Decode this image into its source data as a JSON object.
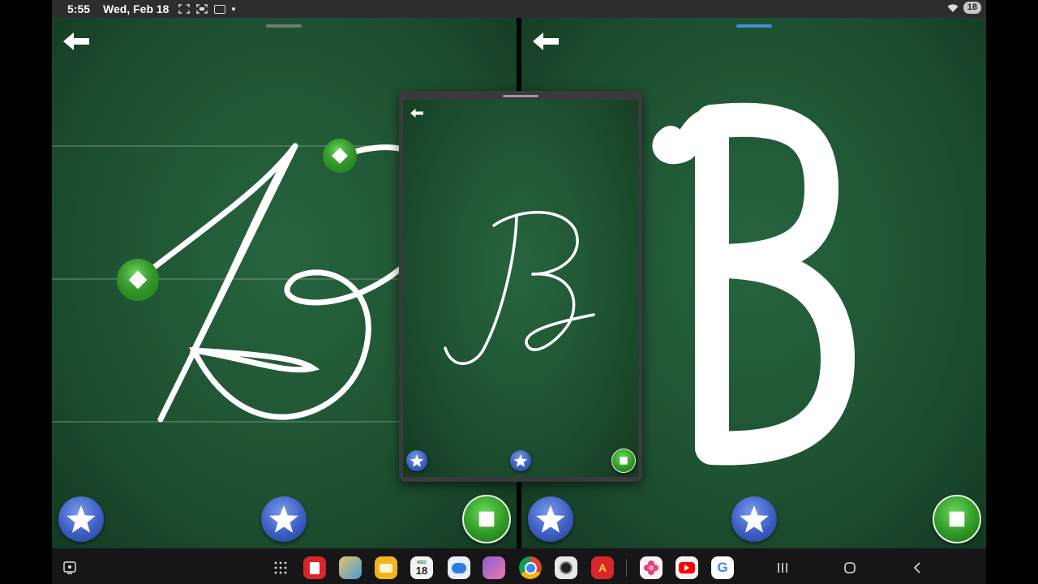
{
  "status_bar": {
    "time": "5:55",
    "date": "Wed, Feb 18",
    "battery": "18"
  },
  "left_pane": {
    "icons": [
      "back-arrow-icon",
      "star-icon",
      "star-icon",
      "stop-icon"
    ],
    "letter_shown": "cursive capital A with tracing guide dots"
  },
  "right_pane": {
    "icons": [
      "back-arrow-icon",
      "star-icon",
      "star-icon",
      "stop-icon"
    ],
    "letter_shown": "print capital B"
  },
  "popup": {
    "icons": [
      "back-arrow-icon",
      "star-icon",
      "star-icon",
      "stop-icon"
    ],
    "letter_shown": "cursive capital B"
  },
  "taskbar": {
    "calendar_day": "18",
    "calendar_weekday": "WED",
    "apps": [
      "app-drawer",
      "notes",
      "game-app",
      "files",
      "calendar",
      "messages",
      "kids-app",
      "chrome",
      "camera",
      "abc-app",
      "gallery",
      "youtube",
      "google"
    ],
    "nav": [
      "recents",
      "home",
      "back"
    ]
  },
  "colors": {
    "board_green": "#1e5232",
    "star_blue": "#3d5fc4",
    "stop_green": "#2f9a26",
    "right_handle_blue": "#3e8fd8"
  }
}
